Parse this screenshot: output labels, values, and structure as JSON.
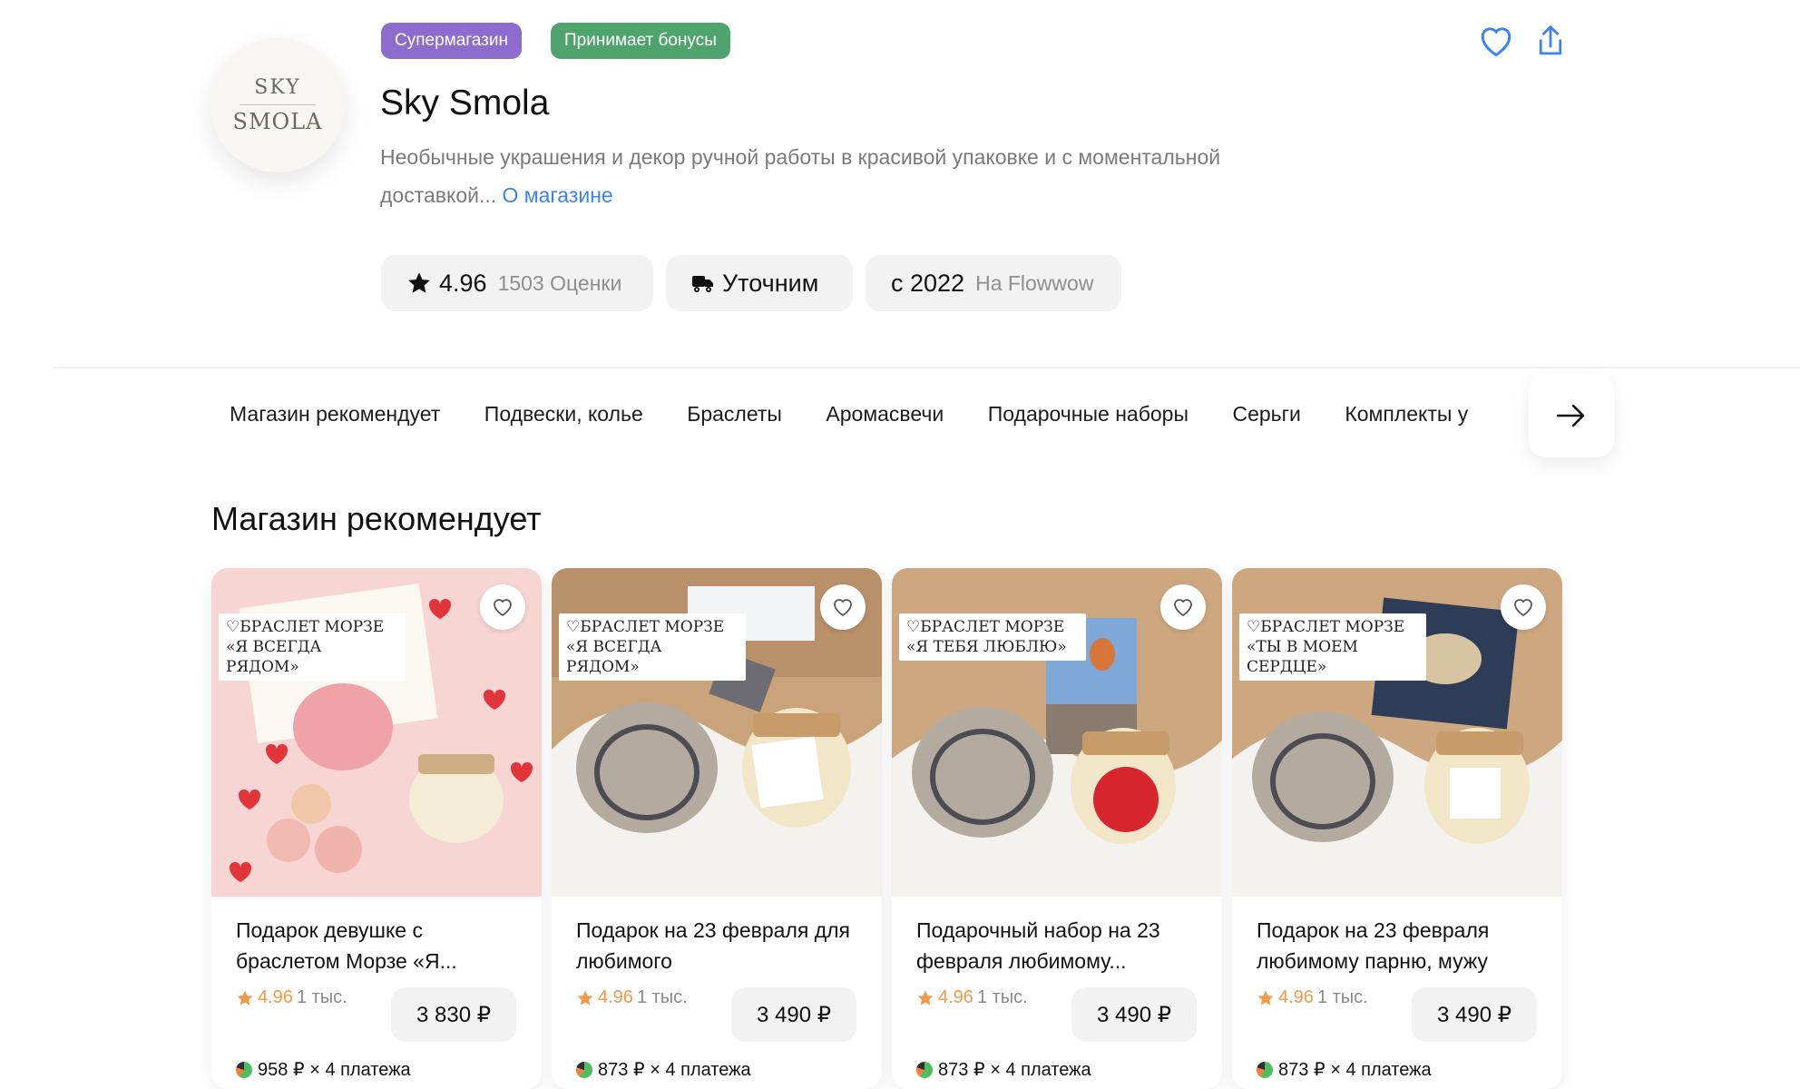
{
  "shop": {
    "avatar_line1": "SKY",
    "avatar_line2": "SMOLA",
    "badges": {
      "super": "Супермагазин",
      "bonus": "Принимает бонусы"
    },
    "title": "Sky Smola",
    "description": "Необычные украшения и декор ручной работы в красивой упаковке и с моментальной доставкой...",
    "about_link": "О магазине",
    "rating": {
      "value": "4.96",
      "count": "1503 Оценки"
    },
    "delivery": "Уточним",
    "since": {
      "year": "с 2022",
      "platform": "На Flowwow"
    }
  },
  "icons": {
    "favorite": "heart-icon",
    "share": "share-icon",
    "tabs_next": "arrow-right-icon",
    "star": "star-icon",
    "delivery": "truck-icon"
  },
  "tabs": [
    "Магазин рекомендует",
    "Подвески, колье",
    "Браслеты",
    "Аромасвечи",
    "Подарочные наборы",
    "Серьги",
    "Комплекты у"
  ],
  "section_title": "Магазин рекомендует",
  "products": [
    {
      "image_label": "♡БРАСЛЕТ МОРЗЕ «Я ВСЕГДА РЯДОМ»",
      "name": "Подарок девушке с браслетом Морзе «Я...",
      "rating": "4.96",
      "reviews": "1 тыс.",
      "price": "3 830 ₽",
      "installments": "958 ₽ × 4 платежа"
    },
    {
      "image_label": "♡БРАСЛЕТ МОРЗЕ «Я ВСЕГДА РЯДОМ»",
      "name": "Подарок на 23 февраля для любимого",
      "rating": "4.96",
      "reviews": "1 тыс.",
      "price": "3 490 ₽",
      "installments": "873 ₽ × 4 платежа"
    },
    {
      "image_label": "♡БРАСЛЕТ МОРЗЕ «Я ТЕБЯ ЛЮБЛЮ»",
      "name": "Подарочный набор на 23 февраля любимому...",
      "rating": "4.96",
      "reviews": "1 тыс.",
      "price": "3 490 ₽",
      "installments": "873 ₽ × 4 платежа"
    },
    {
      "image_label": "♡БРАСЛЕТ МОРЗЕ «ТЫ В МОЕМ СЕРДЦЕ»",
      "name": "Подарок на 23 февраля любимому парню, мужу",
      "rating": "4.96",
      "reviews": "1 тыс.",
      "price": "3 490 ₽",
      "installments": "873 ₽ × 4 платежа"
    }
  ],
  "colors": {
    "super_badge": "#8c6dcd",
    "bonus_badge": "#4fa46e",
    "link": "#3b82f6",
    "rating": "#f2994a"
  }
}
